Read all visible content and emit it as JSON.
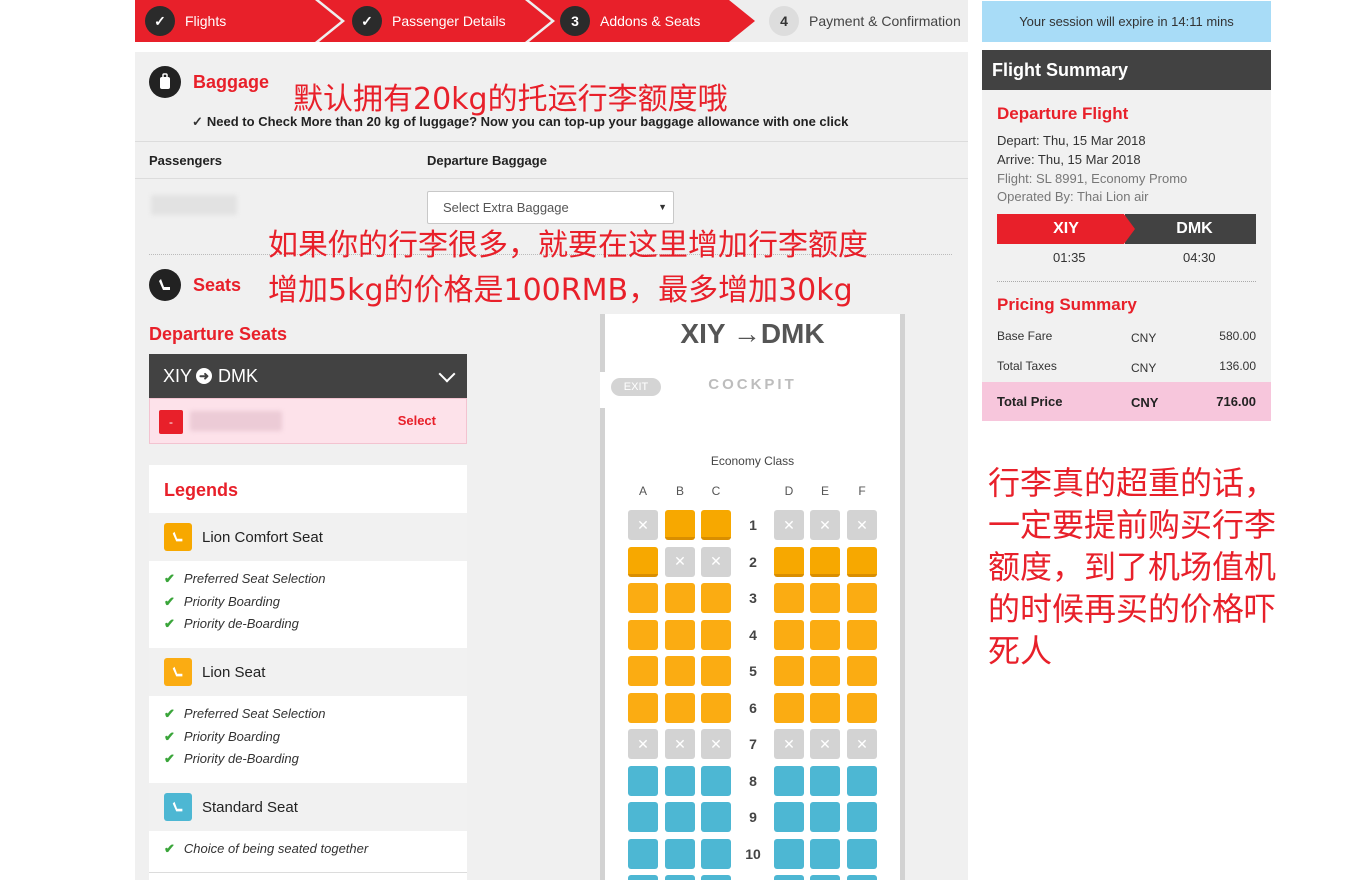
{
  "steps": [
    {
      "label": "Flights",
      "marker": "✓"
    },
    {
      "label": "Passenger Details",
      "marker": "✓"
    },
    {
      "label": "Addons & Seats",
      "marker": "3"
    },
    {
      "label": "Payment & Confirmation",
      "marker": "4"
    }
  ],
  "baggage": {
    "title": "Baggage",
    "note": "Need to Check More than 20 kg of luggage? Now you can top-up your baggage allowance with one click",
    "col_passengers": "Passengers",
    "col_departure_baggage": "Departure Baggage",
    "select_placeholder": "Select Extra Baggage"
  },
  "seats": {
    "title": "Seats",
    "departure_title": "Departure Seats",
    "route_from": "XIY",
    "route_to": "DMK",
    "minus": "-",
    "select_label": "Select"
  },
  "legends": {
    "title": "Legends",
    "groups": [
      {
        "name": "Lion Comfort Seat",
        "color": "#f7a800",
        "items": [
          "Preferred Seat Selection",
          "Priority Boarding",
          "Priority de-Boarding"
        ]
      },
      {
        "name": "Lion Seat",
        "color": "#fbac12",
        "items": [
          "Preferred Seat Selection",
          "Priority Boarding",
          "Priority de-Boarding"
        ]
      },
      {
        "name": "Standard Seat",
        "color": "#4db7d3",
        "items": [
          "Choice of being seated together"
        ]
      }
    ]
  },
  "seatmap": {
    "route_from": "XIY",
    "route_to": "DMK",
    "arrow": "→",
    "exit": "EXIT",
    "cockpit": "COCKPIT",
    "cabin_class": "Economy Class",
    "columns": [
      "A",
      "B",
      "C",
      "D",
      "E",
      "F"
    ],
    "rows": [
      {
        "num": "1",
        "seats": [
          "na",
          "comfort",
          "comfort",
          "na",
          "na",
          "na"
        ]
      },
      {
        "num": "2",
        "seats": [
          "comfort",
          "na",
          "na",
          "comfort",
          "comfort",
          "comfort"
        ]
      },
      {
        "num": "3",
        "seats": [
          "lion",
          "lion",
          "lion",
          "lion",
          "lion",
          "lion"
        ]
      },
      {
        "num": "4",
        "seats": [
          "lion",
          "lion",
          "lion",
          "lion",
          "lion",
          "lion"
        ]
      },
      {
        "num": "5",
        "seats": [
          "lion",
          "lion",
          "lion",
          "lion",
          "lion",
          "lion"
        ]
      },
      {
        "num": "6",
        "seats": [
          "lion",
          "lion",
          "lion",
          "lion",
          "lion",
          "lion"
        ]
      },
      {
        "num": "7",
        "seats": [
          "na",
          "na",
          "na",
          "na",
          "na",
          "na"
        ]
      },
      {
        "num": "8",
        "seats": [
          "std",
          "std",
          "std",
          "std",
          "std",
          "std"
        ]
      },
      {
        "num": "9",
        "seats": [
          "std",
          "std",
          "std",
          "std",
          "std",
          "std"
        ]
      },
      {
        "num": "10",
        "seats": [
          "std",
          "std",
          "std",
          "std",
          "std",
          "std"
        ]
      },
      {
        "num": "",
        "seats": [
          "std",
          "std",
          "std",
          "std",
          "std",
          "std"
        ]
      }
    ]
  },
  "session": {
    "text": "Your session will expire in 14:11 mins"
  },
  "summary": {
    "title": "Flight Summary",
    "departure_title": "Departure Flight",
    "depart": "Depart: Thu, 15 Mar 2018",
    "arrive": "Arrive: Thu, 15 Mar 2018",
    "flight": "Flight: SL 8991, Economy Promo",
    "operated": "Operated By: Thai Lion air",
    "from": "XIY",
    "to": "DMK",
    "dep_time": "01:35",
    "arr_time": "04:30",
    "pricing_title": "Pricing Summary",
    "base_fare": {
      "label": "Base Fare",
      "currency": "CNY",
      "amount": "580.00"
    },
    "total_taxes": {
      "label": "Total Taxes",
      "currency": "CNY",
      "amount": "136.00"
    },
    "total_price": {
      "label": "Total Price",
      "currency": "CNY",
      "amount": "716.00"
    }
  },
  "annotations": {
    "a1": "默认拥有20kg的托运行李额度哦",
    "a2_line1": "如果你的行李很多，就要在这里增加行李额度",
    "a2_line2": "增加5kg的价格是100RMB，最多增加30kg",
    "a3_lines": [
      "行李真的超重的话，",
      "一定要提前购买行李",
      "额度，到了机场值机",
      "的时候再买的价格吓",
      "死人"
    ]
  },
  "colors": {
    "accent": "#e8202a",
    "dark": "#424242",
    "session": "#a8dcf7",
    "total": "#f7c6dc"
  }
}
